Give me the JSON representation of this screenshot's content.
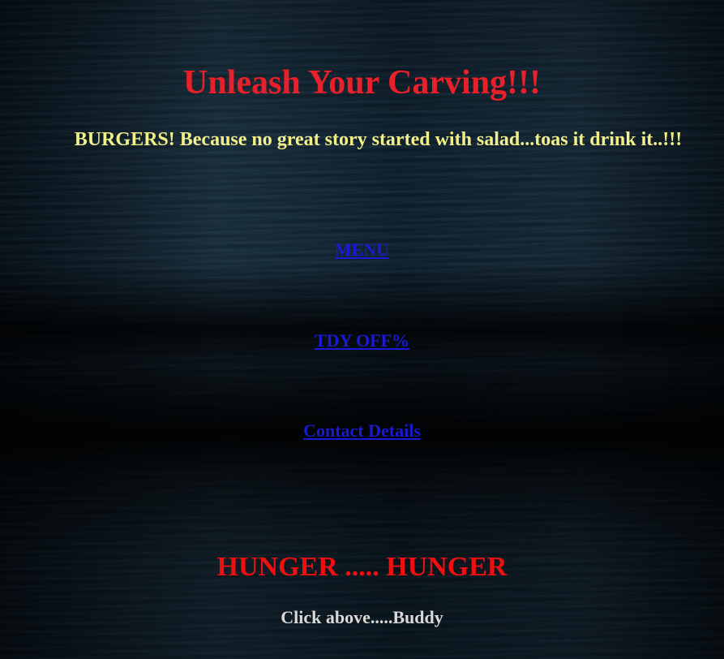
{
  "header": {
    "title": "Unleash Your Carving!!!",
    "tagline": "BURGERS! Because no great story started with salad...toas it drink it..!!!"
  },
  "nav": {
    "links": [
      {
        "label": "MENU"
      },
      {
        "label": "TDY OFF%"
      },
      {
        "label": "Contact Details"
      }
    ]
  },
  "footer": {
    "heading": "HUNGER ..... HUNGER",
    "subtext": "Click above.....Buddy"
  },
  "colors": {
    "title": "#e8202a",
    "tagline": "#f3f08a",
    "link": "#1a1ad6",
    "heading": "#ee1010",
    "subtext": "#d9d9d9"
  }
}
